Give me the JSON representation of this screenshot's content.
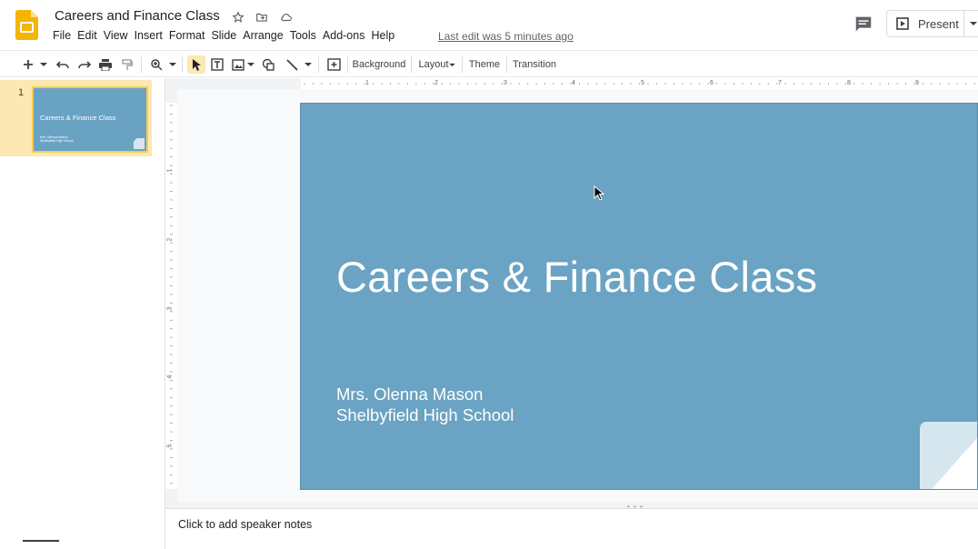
{
  "app": {
    "title": "Careers and Finance Class",
    "last_edit": "Last edit was 5 minutes ago",
    "present_label": "Present"
  },
  "menu": [
    "File",
    "Edit",
    "View",
    "Insert",
    "Format",
    "Slide",
    "Arrange",
    "Tools",
    "Add-ons",
    "Help"
  ],
  "toolbar": {
    "background": "Background",
    "layout": "Layout",
    "theme": "Theme",
    "transition": "Transition"
  },
  "filmstrip": {
    "slide_number": "1",
    "thumb_title": "Careers & Finance Class",
    "thumb_sub_1": "Mrs. Olenna Mason",
    "thumb_sub_2": "Shelbyfield High School"
  },
  "ruler": {
    "top": [
      "1",
      "2",
      "3",
      "4",
      "5",
      "6",
      "7",
      "8",
      "9"
    ],
    "left": [
      "1",
      "2",
      "3",
      "4",
      "5"
    ]
  },
  "slide": {
    "title": "Careers & Finance Class",
    "subtitle_line1": "Mrs. Olenna Mason",
    "subtitle_line2": "Shelbyfield High School"
  },
  "notes": {
    "placeholder": "Click to add speaker notes"
  },
  "colors": {
    "slide_bg": "#6aa3c3",
    "selection": "#fce8b2",
    "logo": "#f4b400"
  }
}
